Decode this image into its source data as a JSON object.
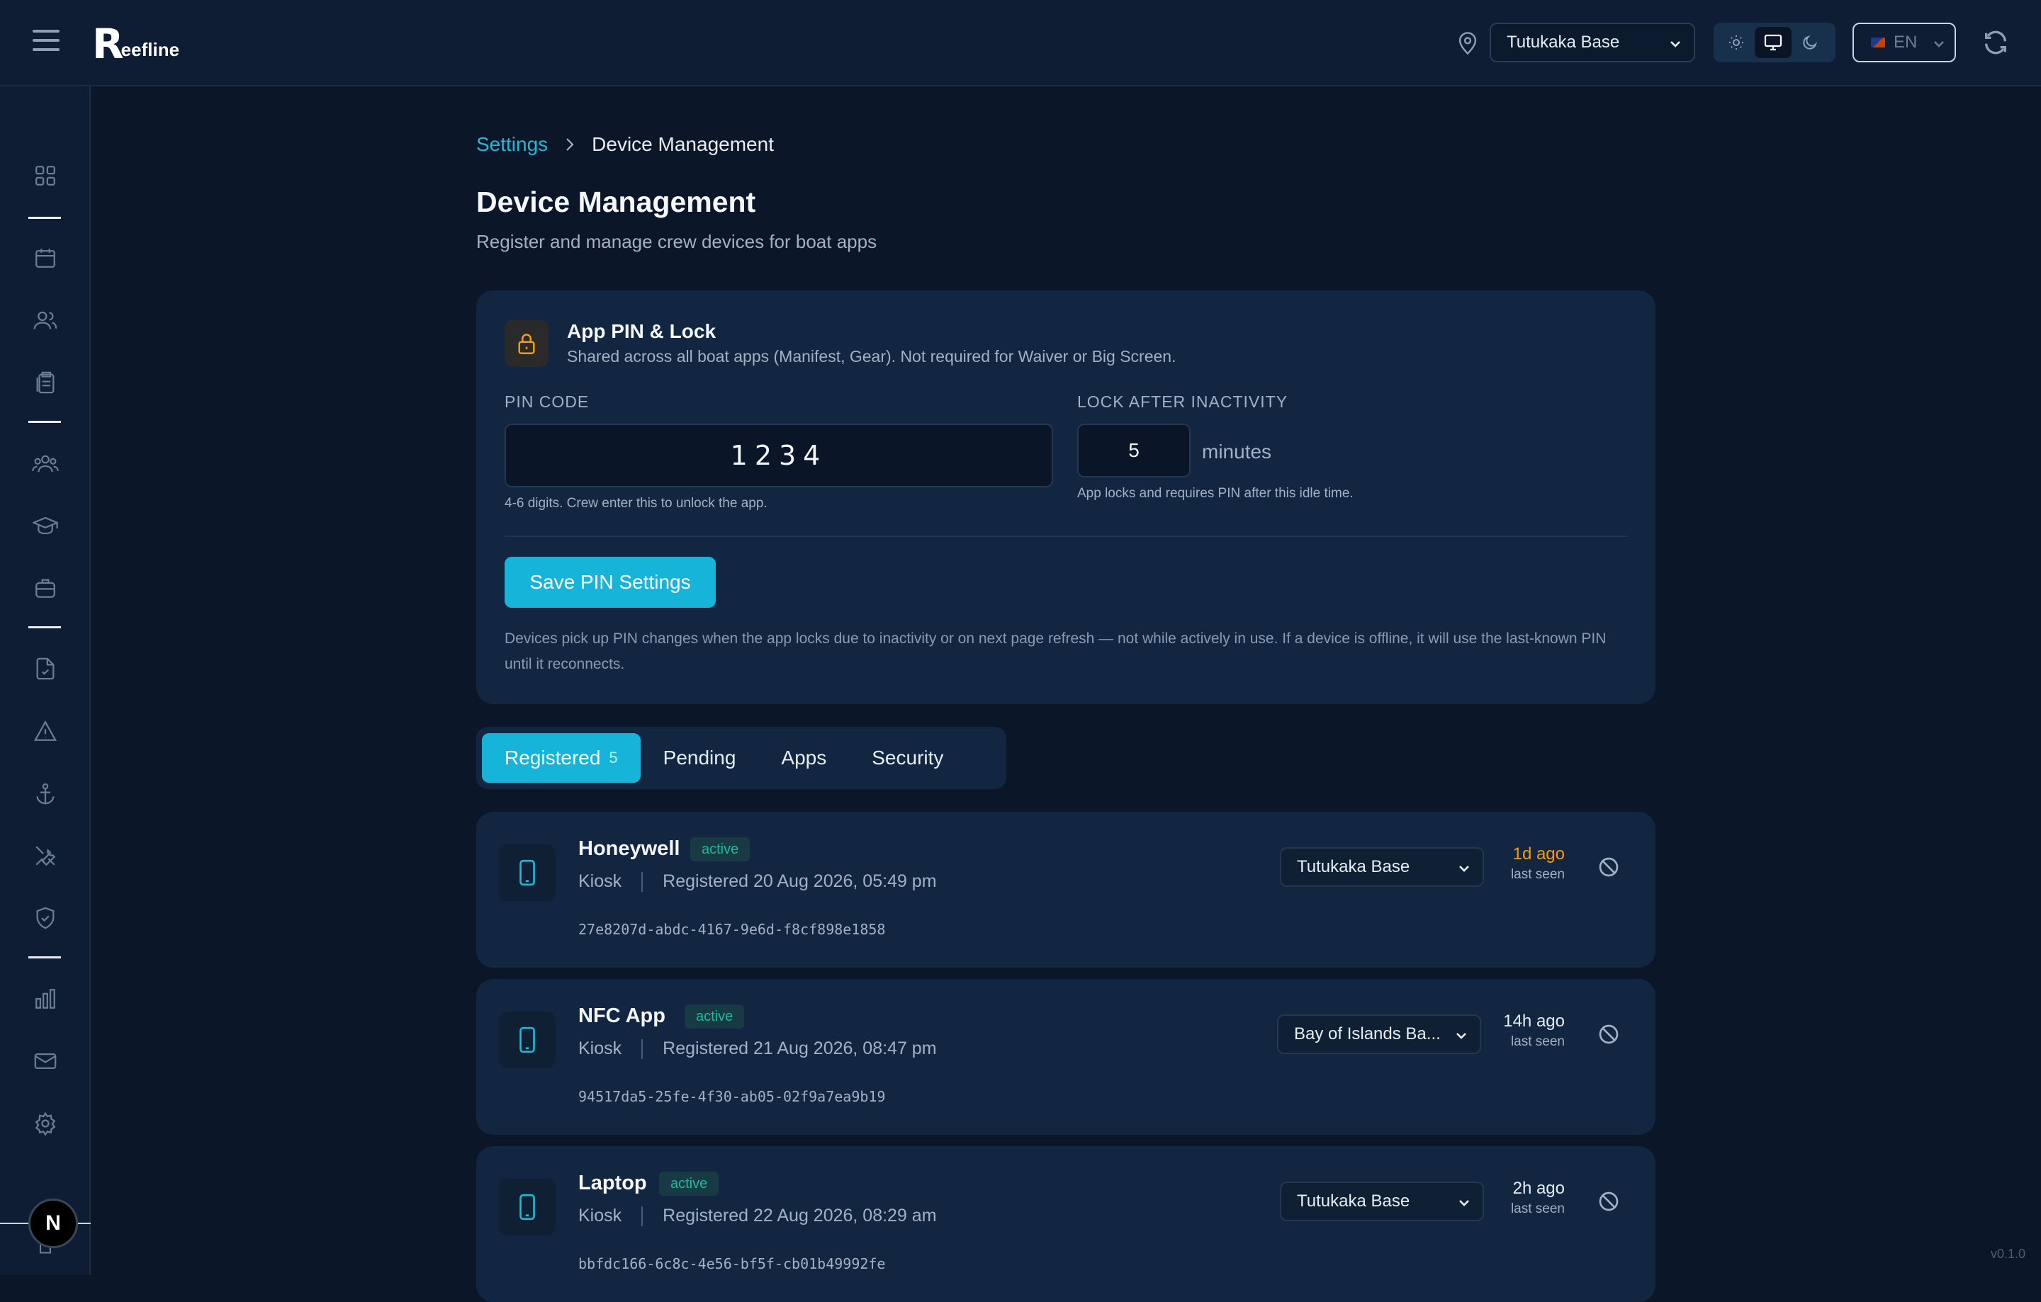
{
  "app": {
    "logo_mark": "R",
    "logo_text": "eefline",
    "version": "v0.1.0"
  },
  "header": {
    "base_select": "Tutukaka Base",
    "language": "EN",
    "theme_modes": [
      "sun-icon",
      "monitor-icon",
      "moon-icon"
    ],
    "theme_active": "monitor-icon"
  },
  "sidebar": {
    "icons": [
      "dashboard-icon",
      "calendar-icon",
      "users-icon",
      "clipboard-icon",
      "group-icon",
      "graduation-cap-icon",
      "briefcase-icon",
      "file-check-icon",
      "alert-icon",
      "anchor-icon",
      "tools-icon",
      "shield-check-icon",
      "bar-chart-icon",
      "mail-icon",
      "settings-icon"
    ],
    "avatar": "N"
  },
  "breadcrumb": {
    "parent": "Settings",
    "current": "Device Management"
  },
  "page": {
    "title": "Device Management",
    "subtitle": "Register and manage crew devices for boat apps"
  },
  "pin_card": {
    "title": "App PIN & Lock",
    "description": "Shared across all boat apps (Manifest, Gear). Not required for Waiver or Big Screen.",
    "pin_label": "PIN CODE",
    "pin_value": "1234",
    "pin_hint": "4-6 digits. Crew enter this to unlock the app.",
    "lock_label": "LOCK AFTER INACTIVITY",
    "lock_value": "5",
    "lock_unit": "minutes",
    "lock_hint": "App locks and requires PIN after this idle time.",
    "save_label": "Save PIN Settings",
    "note": "Devices pick up PIN changes when the app locks due to inactivity or on next page refresh — not while actively in use. If a device is offline, it will use the last-known PIN until it reconnects."
  },
  "tabs": [
    {
      "label": "Registered",
      "count": "5",
      "active": true
    },
    {
      "label": "Pending"
    },
    {
      "label": "Apps"
    },
    {
      "label": "Security"
    }
  ],
  "devices": [
    {
      "name": "Honeywell",
      "status": "active",
      "type": "Kiosk",
      "registered": "Registered 20 Aug 2026, 05:49 pm",
      "id": "27e8207d-abdc-4167-9e6d-f8cf898e1858",
      "base": "Tutukaka Base",
      "last_seen": "1d ago",
      "last_seen_label": "last seen",
      "stale": true
    },
    {
      "name": "NFC App",
      "status": "active",
      "type": "Kiosk",
      "registered": "Registered 21 Aug 2026, 08:47 pm",
      "id": "94517da5-25fe-4f30-ab05-02f9a7ea9b19",
      "base": "Bay of Islands Ba...",
      "last_seen": "14h ago",
      "last_seen_label": "last seen",
      "stale": false
    },
    {
      "name": "Laptop",
      "status": "active",
      "type": "Kiosk",
      "registered": "Registered 22 Aug 2026, 08:29 am",
      "id": "bbfdc166-6c8c-4e56-bf5f-cb01b49992fe",
      "base": "Tutukaka Base",
      "last_seen": "2h ago",
      "last_seen_label": "last seen",
      "stale": false
    }
  ]
}
